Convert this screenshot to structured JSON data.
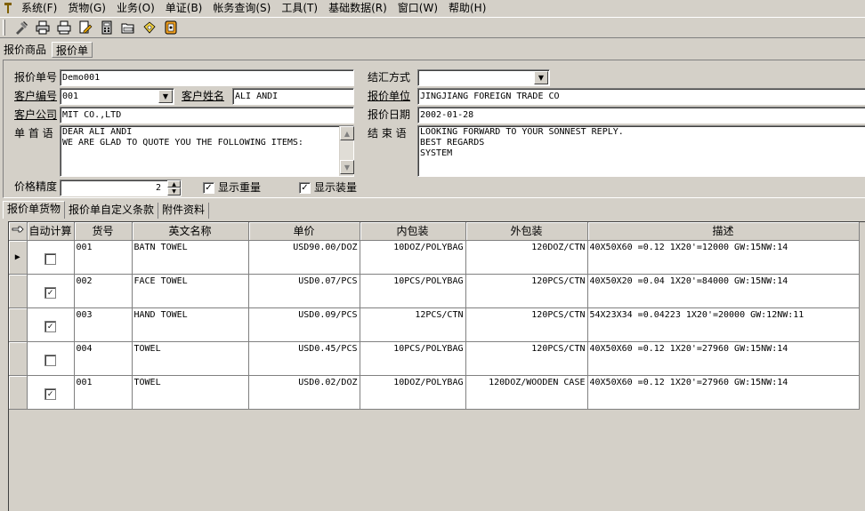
{
  "menu": {
    "items": [
      "系统(F)",
      "货物(G)",
      "业务(O)",
      "单证(B)",
      "帐务查询(S)",
      "工具(T)",
      "基础数据(R)",
      "窗口(W)",
      "帮助(H)"
    ]
  },
  "toolbar": {
    "icons": [
      "tools-icon",
      "print-icon",
      "print-preview-icon",
      "edit-icon",
      "calculator-icon",
      "folder-icon",
      "hand-icon",
      "exit-icon"
    ]
  },
  "top_tabs": [
    "报价商品",
    "报价单"
  ],
  "form": {
    "quote_no_label": "报价单号",
    "quote_no": "Demo001",
    "customer_code_label": "客户编号",
    "customer_code": "001",
    "customer_name_label": "客户姓名",
    "customer_name": "ALI ANDI",
    "customer_company_label": "客户公司",
    "customer_company": "MIT CO.,LTD",
    "header_text_label": "单 首 语",
    "header_text": [
      "DEAR ALI ANDI",
      "WE ARE GLAD TO QUOTE YOU THE FOLLOWING ITEMS:"
    ],
    "settlement_label": "结汇方式",
    "settlement": "",
    "quote_unit_label": "报价单位",
    "quote_unit": "JINGJIANG FOREIGN TRADE CO",
    "quote_date_label": "报价日期",
    "quote_date": "2002-01-28",
    "footer_text_label": "结 束 语",
    "footer_text": [
      "LOOKING FORWARD TO YOUR SONNEST REPLY.",
      "BEST REGARDS",
      "SYSTEM"
    ],
    "price_precision_label": "价格精度",
    "price_precision": "2",
    "show_weight_label": "显示重量",
    "show_weight_checked": "✓",
    "show_packing_label": "显示装量",
    "show_packing_checked": "✓"
  },
  "sub_tabs": [
    "报价单货物",
    "报价单自定义条款",
    "附件资料"
  ],
  "grid": {
    "columns": [
      "自动计算",
      "货号",
      "英文名称",
      "单价",
      "内包装",
      "外包装",
      "描述"
    ],
    "rows": [
      {
        "auto": "",
        "item_no": "001",
        "name": "BATN TOWEL",
        "price": "USD90.00/DOZ",
        "inner": "10DOZ/POLYBAG",
        "outer": "120DOZ/CTN",
        "desc": "40X50X60 =0.12 1X20'=12000 GW:15NW:14"
      },
      {
        "auto": "✓",
        "item_no": "002",
        "name": "FACE TOWEL",
        "price": "USD0.07/PCS",
        "inner": "10PCS/POLYBAG",
        "outer": "120PCS/CTN",
        "desc": "40X50X20 =0.04 1X20'=84000 GW:15NW:14"
      },
      {
        "auto": "✓",
        "item_no": "003",
        "name": "HAND TOWEL",
        "price": "USD0.09/PCS",
        "inner": "12PCS/CTN",
        "outer": "120PCS/CTN",
        "desc": "54X23X34 =0.04223 1X20'=20000 GW:12NW:11"
      },
      {
        "auto": "",
        "item_no": "004",
        "name": "TOWEL",
        "price": "USD0.45/PCS",
        "inner": "10PCS/POLYBAG",
        "outer": "120PCS/CTN",
        "desc": "40X50X60 =0.12 1X20'=27960 GW:15NW:14"
      },
      {
        "auto": "✓",
        "item_no": "001",
        "name": "TOWEL",
        "price": "USD0.02/DOZ",
        "inner": "10DOZ/POLYBAG",
        "outer": "120DOZ/WOODEN CASE",
        "desc": "40X50X60 =0.12 1X20'=27960 GW:15NW:14"
      }
    ]
  }
}
